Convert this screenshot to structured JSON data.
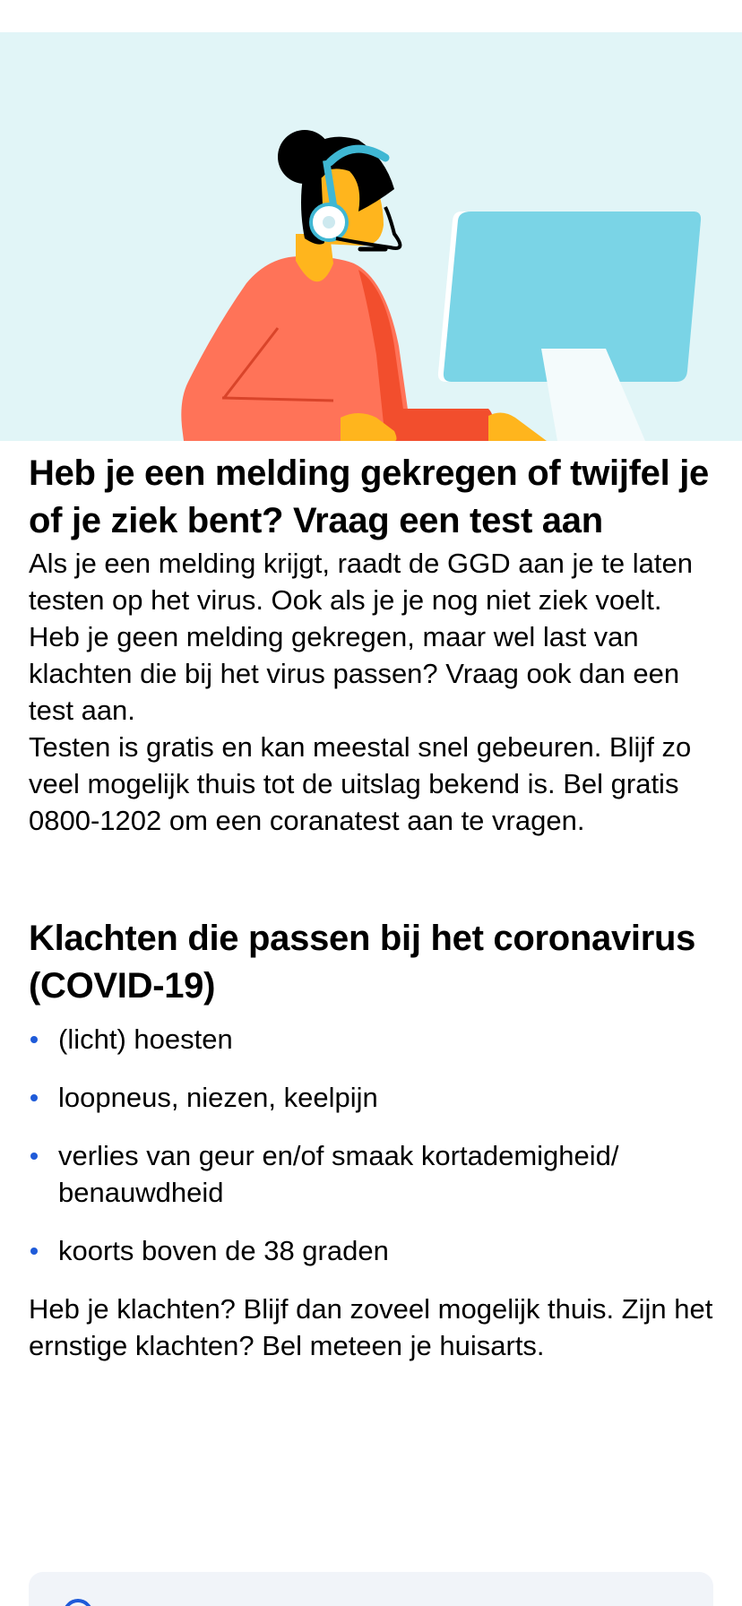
{
  "hero": {
    "icon": "support-agent-illustration",
    "colors": {
      "background": "#e1f5f7",
      "shirt": "#ff7358",
      "skin": "#ffb51d",
      "hair": "#000000",
      "headset": "#3fb7d3",
      "monitor": "#7ad4e6"
    }
  },
  "test_section": {
    "title": "Heb je een melding gekregen of twijfel je of je ziek bent? Vraag een test aan",
    "paragraph_1": "Als je een melding krijgt, raadt de GGD aan je te laten testen op het virus. Ook als je je nog niet ziek voelt. Heb je geen melding gekregen, maar wel last van klachten die bij het virus passen? Vraag ook dan een test aan.",
    "paragraph_2": "Testen is gratis en kan meestal snel gebeuren. Blijf zo veel mogelijk thuis tot de uitslag bekend is. Bel gratis 0800-1202 om een coranatest aan te vragen."
  },
  "symptoms_section": {
    "title": "Klachten die passen bij het coronavirus (COVID-19)",
    "items": [
      "(licht) hoesten",
      "loopneus, niezen, keelpijn",
      "verlies van geur en/of smaak kortademigheid/ benauwdheid",
      "koorts boven de 38 graden"
    ],
    "note": "Heb je klachten? Blijf dan zoveel mogelijk thuis. Zijn het ernstige klachten? Bel meteen je huisarts.",
    "bullet_color": "#1f5bd9"
  },
  "card": {
    "background": "#f1f4f9",
    "icon": "info-icon"
  }
}
